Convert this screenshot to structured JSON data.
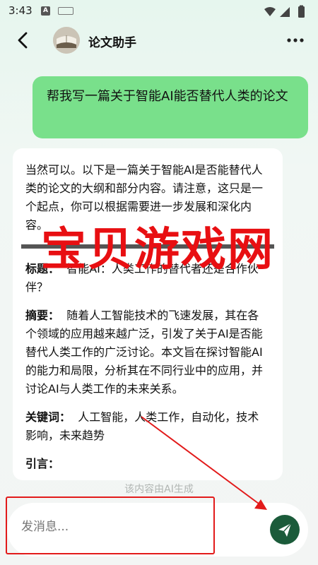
{
  "status_bar": {
    "time": "3:43",
    "notif_letter": "A"
  },
  "header": {
    "title": "论文助手"
  },
  "user_message": "帮我写一篇关于智能AI能否替代人类的论文",
  "ai_response": {
    "intro": "当然可以。以下是一篇关于智能AI是否能替代人类的论文的大纲和部分内容。请注意，这只是一个起点，你可以根据需要进一步发展和深化内容。",
    "title_label": "标题：",
    "title_value": "智能AI：人类工作的替代者还是合作伙伴？",
    "abstract_label": "摘要：",
    "abstract_value": "随着人工智能技术的飞速发展，其在各个领域的应用越来越广泛，引发了关于AI是否能替代人类工作的广泛讨论。本文旨在探讨智能AI的能力和局限，分析其在不同行业中的应用，并讨论AI与人类工作的未来关系。",
    "keywords_label": "关键词：",
    "keywords_value": "人工智能，人类工作，自动化，技术影响，未来趋势",
    "intro_heading": "引言："
  },
  "footnote": "该内容由AI生成",
  "watermark": "宝贝游戏网",
  "input": {
    "placeholder": "发消息..."
  },
  "colors": {
    "user_bubble": "#79e08b",
    "send_button": "#1b5b3a",
    "annotation_red": "#e21a1a"
  }
}
